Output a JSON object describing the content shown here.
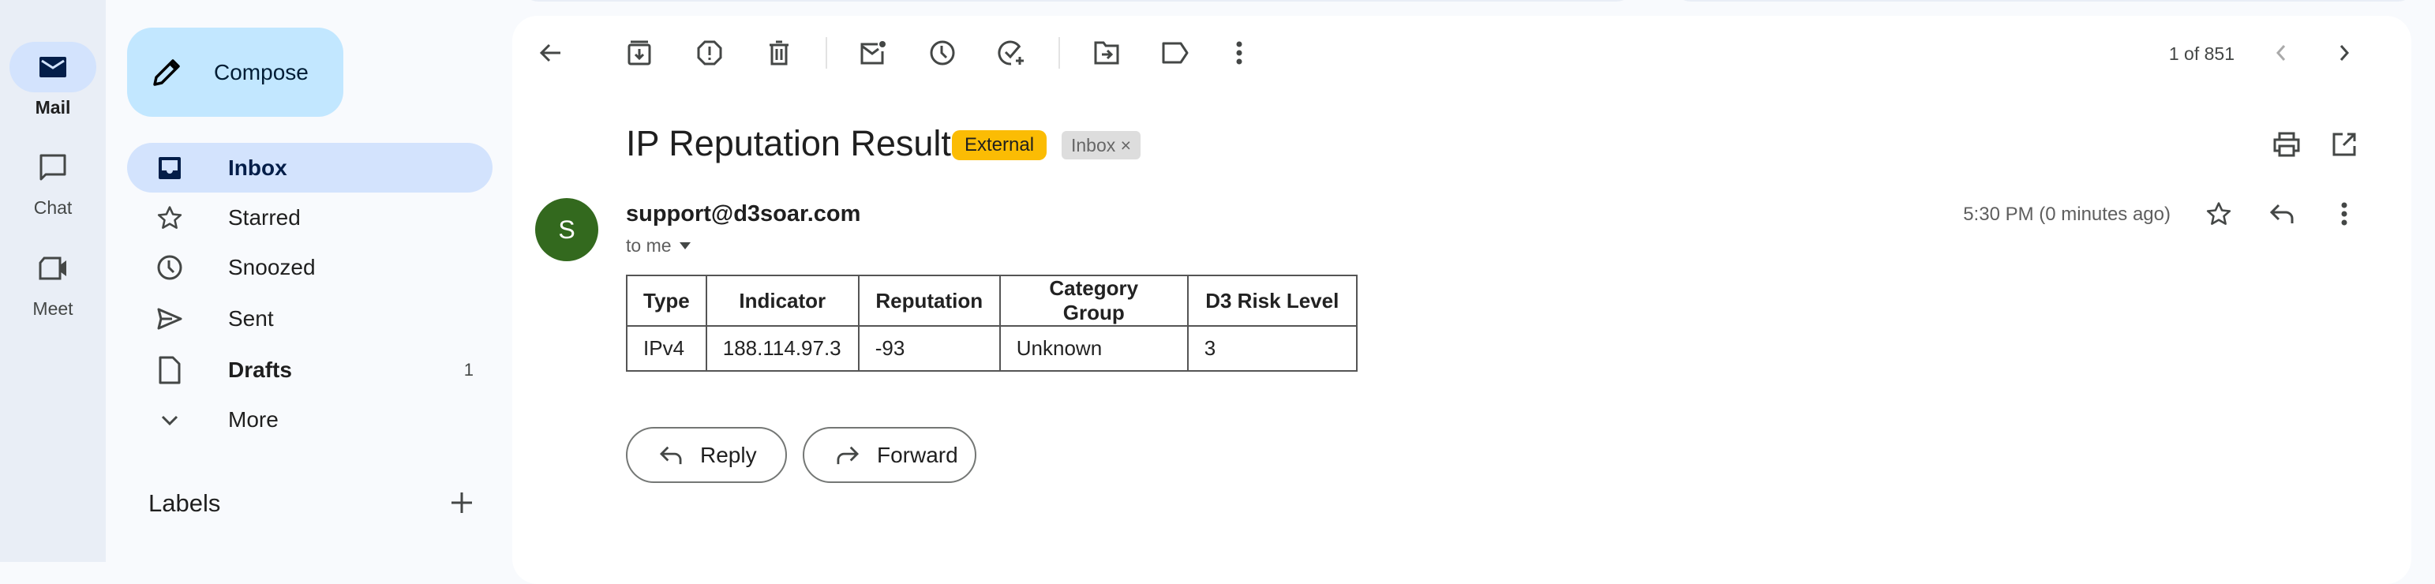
{
  "rail": {
    "items": [
      {
        "label": "Mail",
        "icon": "mail-icon"
      },
      {
        "label": "Chat",
        "icon": "chat-icon"
      },
      {
        "label": "Meet",
        "icon": "video-icon"
      }
    ]
  },
  "sidebar": {
    "compose_label": "Compose",
    "items": [
      {
        "label": "Inbox",
        "icon": "inbox-icon"
      },
      {
        "label": "Starred",
        "icon": "star-icon"
      },
      {
        "label": "Snoozed",
        "icon": "clock-icon"
      },
      {
        "label": "Sent",
        "icon": "send-icon"
      },
      {
        "label": "Drafts",
        "icon": "draft-icon",
        "count": "1"
      },
      {
        "label": "More",
        "icon": "chevron-down-icon"
      }
    ],
    "labels_heading": "Labels"
  },
  "toolbar": {
    "pagination": "1 of 851"
  },
  "email": {
    "subject": "IP Reputation Result",
    "badge_external": "External",
    "chip_inbox": "Inbox",
    "chip_close": "×",
    "avatar_letter": "S",
    "sender": "support@d3soar.com",
    "to": "to me",
    "time": "5:30 PM (0 minutes ago)",
    "table": {
      "headers": [
        "Type",
        "Indicator",
        "Reputation",
        "Category Group",
        "D3 Risk Level"
      ],
      "rows": [
        [
          "IPv4",
          "188.114.97.3",
          "-93",
          "Unknown",
          "3"
        ]
      ]
    },
    "reply_label": "Reply",
    "forward_label": "Forward"
  },
  "colors": {
    "accent": "#c2e7ff",
    "active": "#d3e3fd",
    "external": "#fbbc04",
    "avatar": "#33691e"
  }
}
